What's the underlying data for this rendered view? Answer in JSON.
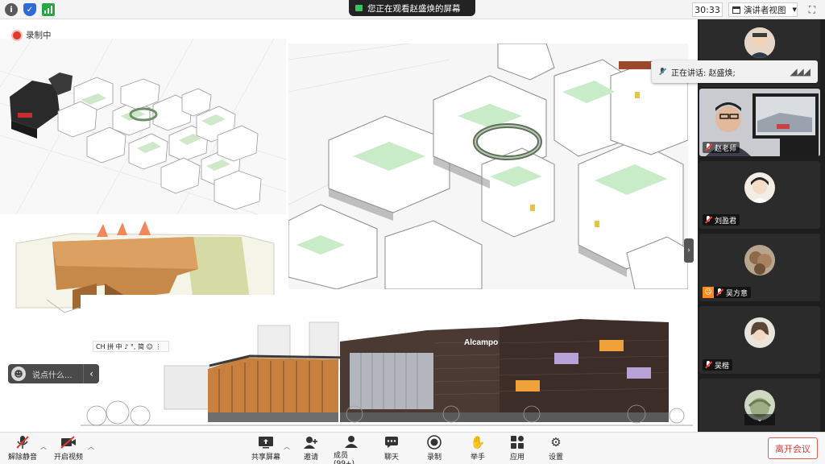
{
  "topbar": {
    "viewing_text": "您正在观看赵盛焕的屏幕",
    "timer": "30:33",
    "view_mode": "演讲者视图",
    "icons": [
      "info-icon",
      "shield-icon",
      "signal-icon",
      "speaker-icon",
      "fullscreen-icon"
    ]
  },
  "share": {
    "recording_label": "录制中",
    "ime_toolbar": "CH 拼 中 ♪ °, 简 ☺ ⋮",
    "chat_placeholder": "说点什么...",
    "mall_sign": "Alcampo"
  },
  "gallery": {
    "speaking_label": "正在讲话: 赵盛焕;",
    "participants": [
      {
        "name": "赵老师"
      },
      {
        "name": "刘盈君"
      },
      {
        "name": "吴方意"
      },
      {
        "name": "吴楷"
      }
    ]
  },
  "toolbar": {
    "unmute": "解除静音",
    "start_video": "开启视频",
    "share_screen": "共享屏幕",
    "invite": "邀请",
    "members": "成员(99+)",
    "chat": "聊天",
    "record": "录制",
    "raise_hand": "举手",
    "apps": "应用",
    "settings": "设置",
    "leave": "离开会议"
  },
  "colors": {
    "record_red": "#e03a2e",
    "leave_red": "#d93d33",
    "gallery_bg": "#1e1e1e"
  }
}
